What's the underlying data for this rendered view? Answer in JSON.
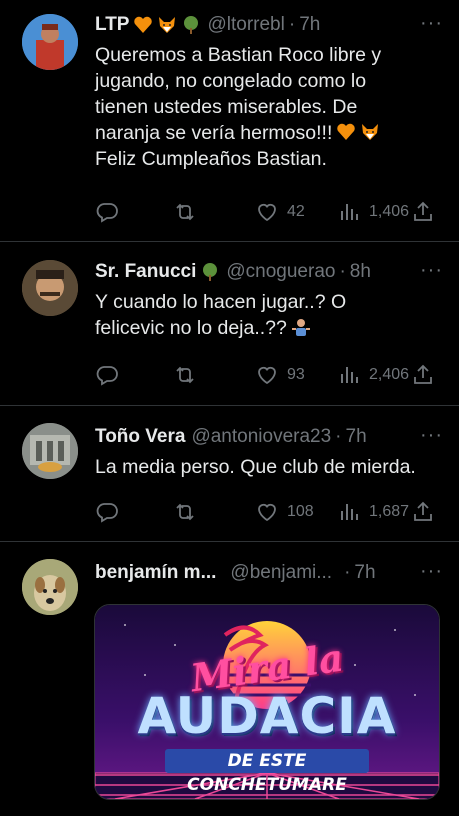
{
  "tweets": [
    {
      "name": "LTP",
      "handle": "@ltorrebl",
      "time": "7h",
      "text_lines": [
        "Queremos a Bastian Roco libre y",
        "jugando, no congelado como lo",
        "tienen ustedes miserables. De",
        "naranja se vería hermoso!!!"
      ],
      "text_last": "Feliz Cumpleaños Bastian.",
      "replies": "",
      "retweets": "",
      "likes": "42",
      "views": "1,406"
    },
    {
      "name": "Sr. Fanucci",
      "handle": "@cnoguerao",
      "time": "8h",
      "text_lines": [
        "Y cuando lo hacen jugar..? O",
        "felicevic no lo deja..??"
      ],
      "likes": "93",
      "views": "2,406"
    },
    {
      "name": "Toño Vera",
      "handle": "@antoniovera23",
      "time": "7h",
      "text_lines": [
        "La media perso. Que club de mierda."
      ],
      "likes": "108",
      "views": "1,687"
    },
    {
      "name": "benjamín m...",
      "handle": "@benjami...",
      "time": "7h",
      "media_text": {
        "top": "Mira la",
        "middle": "AUDACIA",
        "bottom": "DE ESTE CONCHETUMARE"
      }
    }
  ],
  "ui": {
    "dot": "·",
    "more": "···"
  },
  "colors": {
    "background": "#000000",
    "text": "#e7e9ea",
    "muted": "#71767b",
    "divider": "#2f3336"
  }
}
